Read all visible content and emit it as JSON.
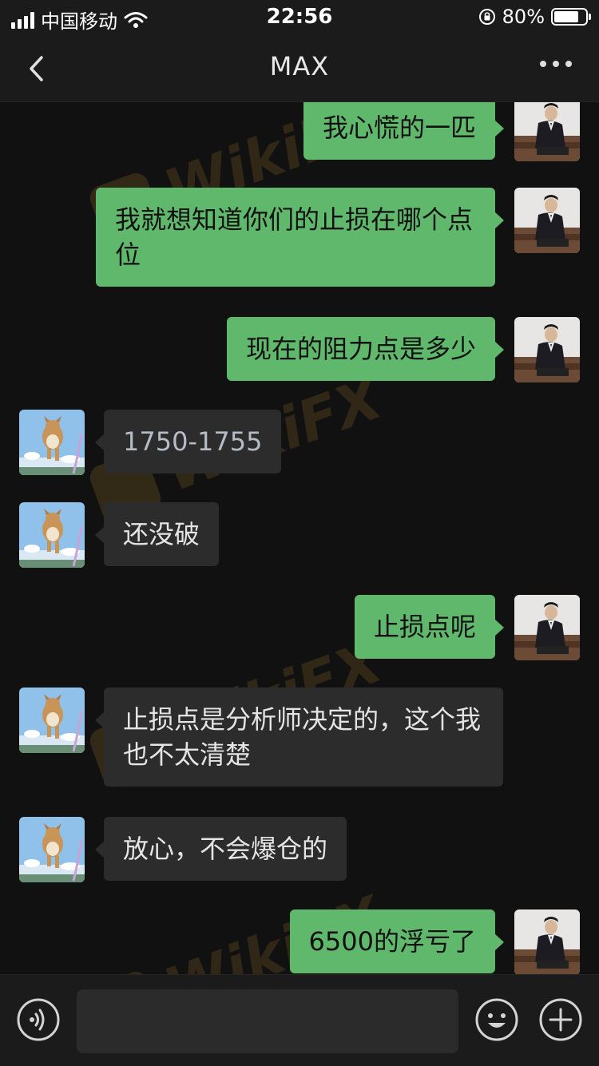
{
  "status_bar": {
    "carrier": "中国移动",
    "time": "22:56",
    "battery": "80%",
    "battery_level": 0.8
  },
  "header": {
    "title": "MAX"
  },
  "messages": [
    {
      "direction": "out",
      "text": "我心慌的一匹"
    },
    {
      "direction": "out",
      "text": "我就想知道你们的止损在哪个点位"
    },
    {
      "direction": "out",
      "text": "现在的阻力点是多少"
    },
    {
      "direction": "in",
      "text": "1750-1755"
    },
    {
      "direction": "in",
      "text": "还没破"
    },
    {
      "direction": "out",
      "text": "止损点呢"
    },
    {
      "direction": "in",
      "text": "止损点是分析师决定的，这个我也不太清楚"
    },
    {
      "direction": "in",
      "text": "放心，不会爆仓的"
    },
    {
      "direction": "out",
      "text": "6500的浮亏了"
    }
  ],
  "input_bar": {
    "value": "",
    "placeholder": ""
  },
  "watermark": "WikiFX",
  "colors": {
    "background": "#111111",
    "bar_background": "#1b1b1b",
    "outgoing_bubble": "#5fb86b",
    "incoming_bubble": "#2c2c2c",
    "watermark": "#d69a34"
  },
  "icons": {
    "back": "chevron-left-icon",
    "more": "more-dots-icon",
    "voice": "voice-icon",
    "emoji": "emoji-icon",
    "plus": "plus-icon"
  }
}
